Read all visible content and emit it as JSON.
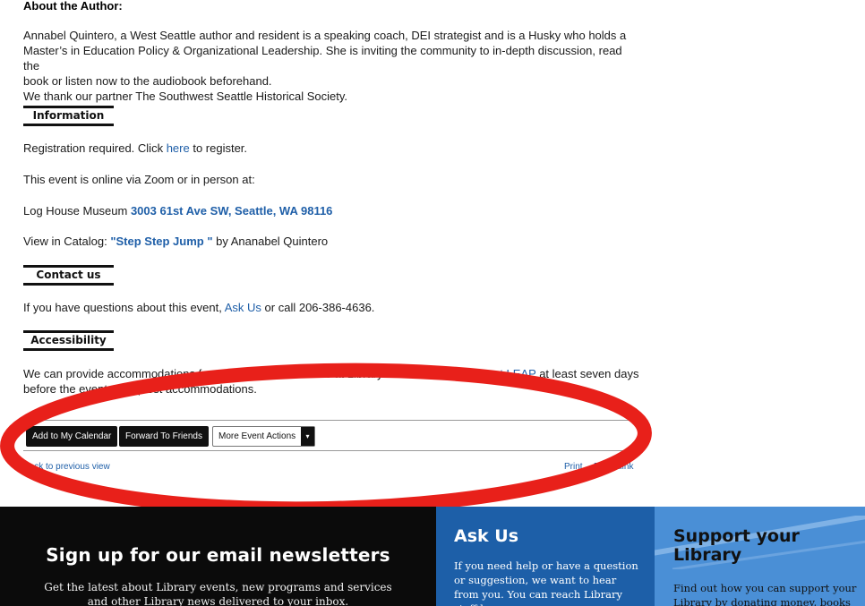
{
  "about": {
    "heading": "About the Author:",
    "bio_line1": "Annabel Quintero, a West Seattle author and resident is a speaking coach, DEI strategist and is a Husky who holds a",
    "bio_line2": "Master’s in Education Policy & Organizational Leadership. She is inviting the community to in-depth discussion, read the",
    "bio_line3": "book or listen now to the audiobook beforehand.",
    "bio_line4": "We thank our partner The Southwest Seattle Historical Society."
  },
  "information": {
    "heading": "Information",
    "registration_prefix": "Registration required. Click ",
    "registration_link": "here",
    "registration_suffix": " to register.",
    "online_text": "This event is online via Zoom or in person at:",
    "venue_prefix": "Log House Museum ",
    "venue_address": "3003 61st Ave SW, Seattle, WA 98116",
    "catalog_prefix": "View in Catalog: ",
    "catalog_title": "\"Step Step Jump \"",
    "catalog_suffix": " by Ananabel Quintero"
  },
  "contact": {
    "heading": "Contact us",
    "prefix": "If you have questions about this event, ",
    "ask_link": "Ask Us",
    "suffix": " or call 206-386-4636."
  },
  "accessibility": {
    "heading": "Accessibility",
    "line1_start": "We can provide accommodations f",
    "line1_mid": "or people with disabilities at Library events. Please ",
    "line1_link": "contact LEAP",
    "line1_end": " at least seven days",
    "line2_start": "before the ev",
    "line2_end": "ent to request accommodations."
  },
  "actions": {
    "add_calendar": "Add to My Calendar",
    "forward": "Forward To Friends",
    "more": "More Event Actions",
    "caret": "▾",
    "back": "Back to previous view",
    "print": "Print",
    "permalink": "Permalink"
  },
  "footer": {
    "newsletter_title": "Sign up for our email newsletters",
    "newsletter_text": "Get the latest about Library events, new programs and services and other Library news delivered to your inbox.",
    "ask_title": "Ask Us",
    "ask_text": "If you need help or have a question or suggestion, we want to hear from you. You can reach Library staff by",
    "support_title_1": "Support your",
    "support_title_2": "Library",
    "support_text": "Find out how you can support your Library by donating money, books or"
  },
  "colors": {
    "link": "#1f5fa8",
    "annotation_red": "#e8201a",
    "newsletter_bg": "#0b0b0b",
    "ask_bg": "#1d5fa8",
    "support_bg": "#4a8fd6"
  }
}
